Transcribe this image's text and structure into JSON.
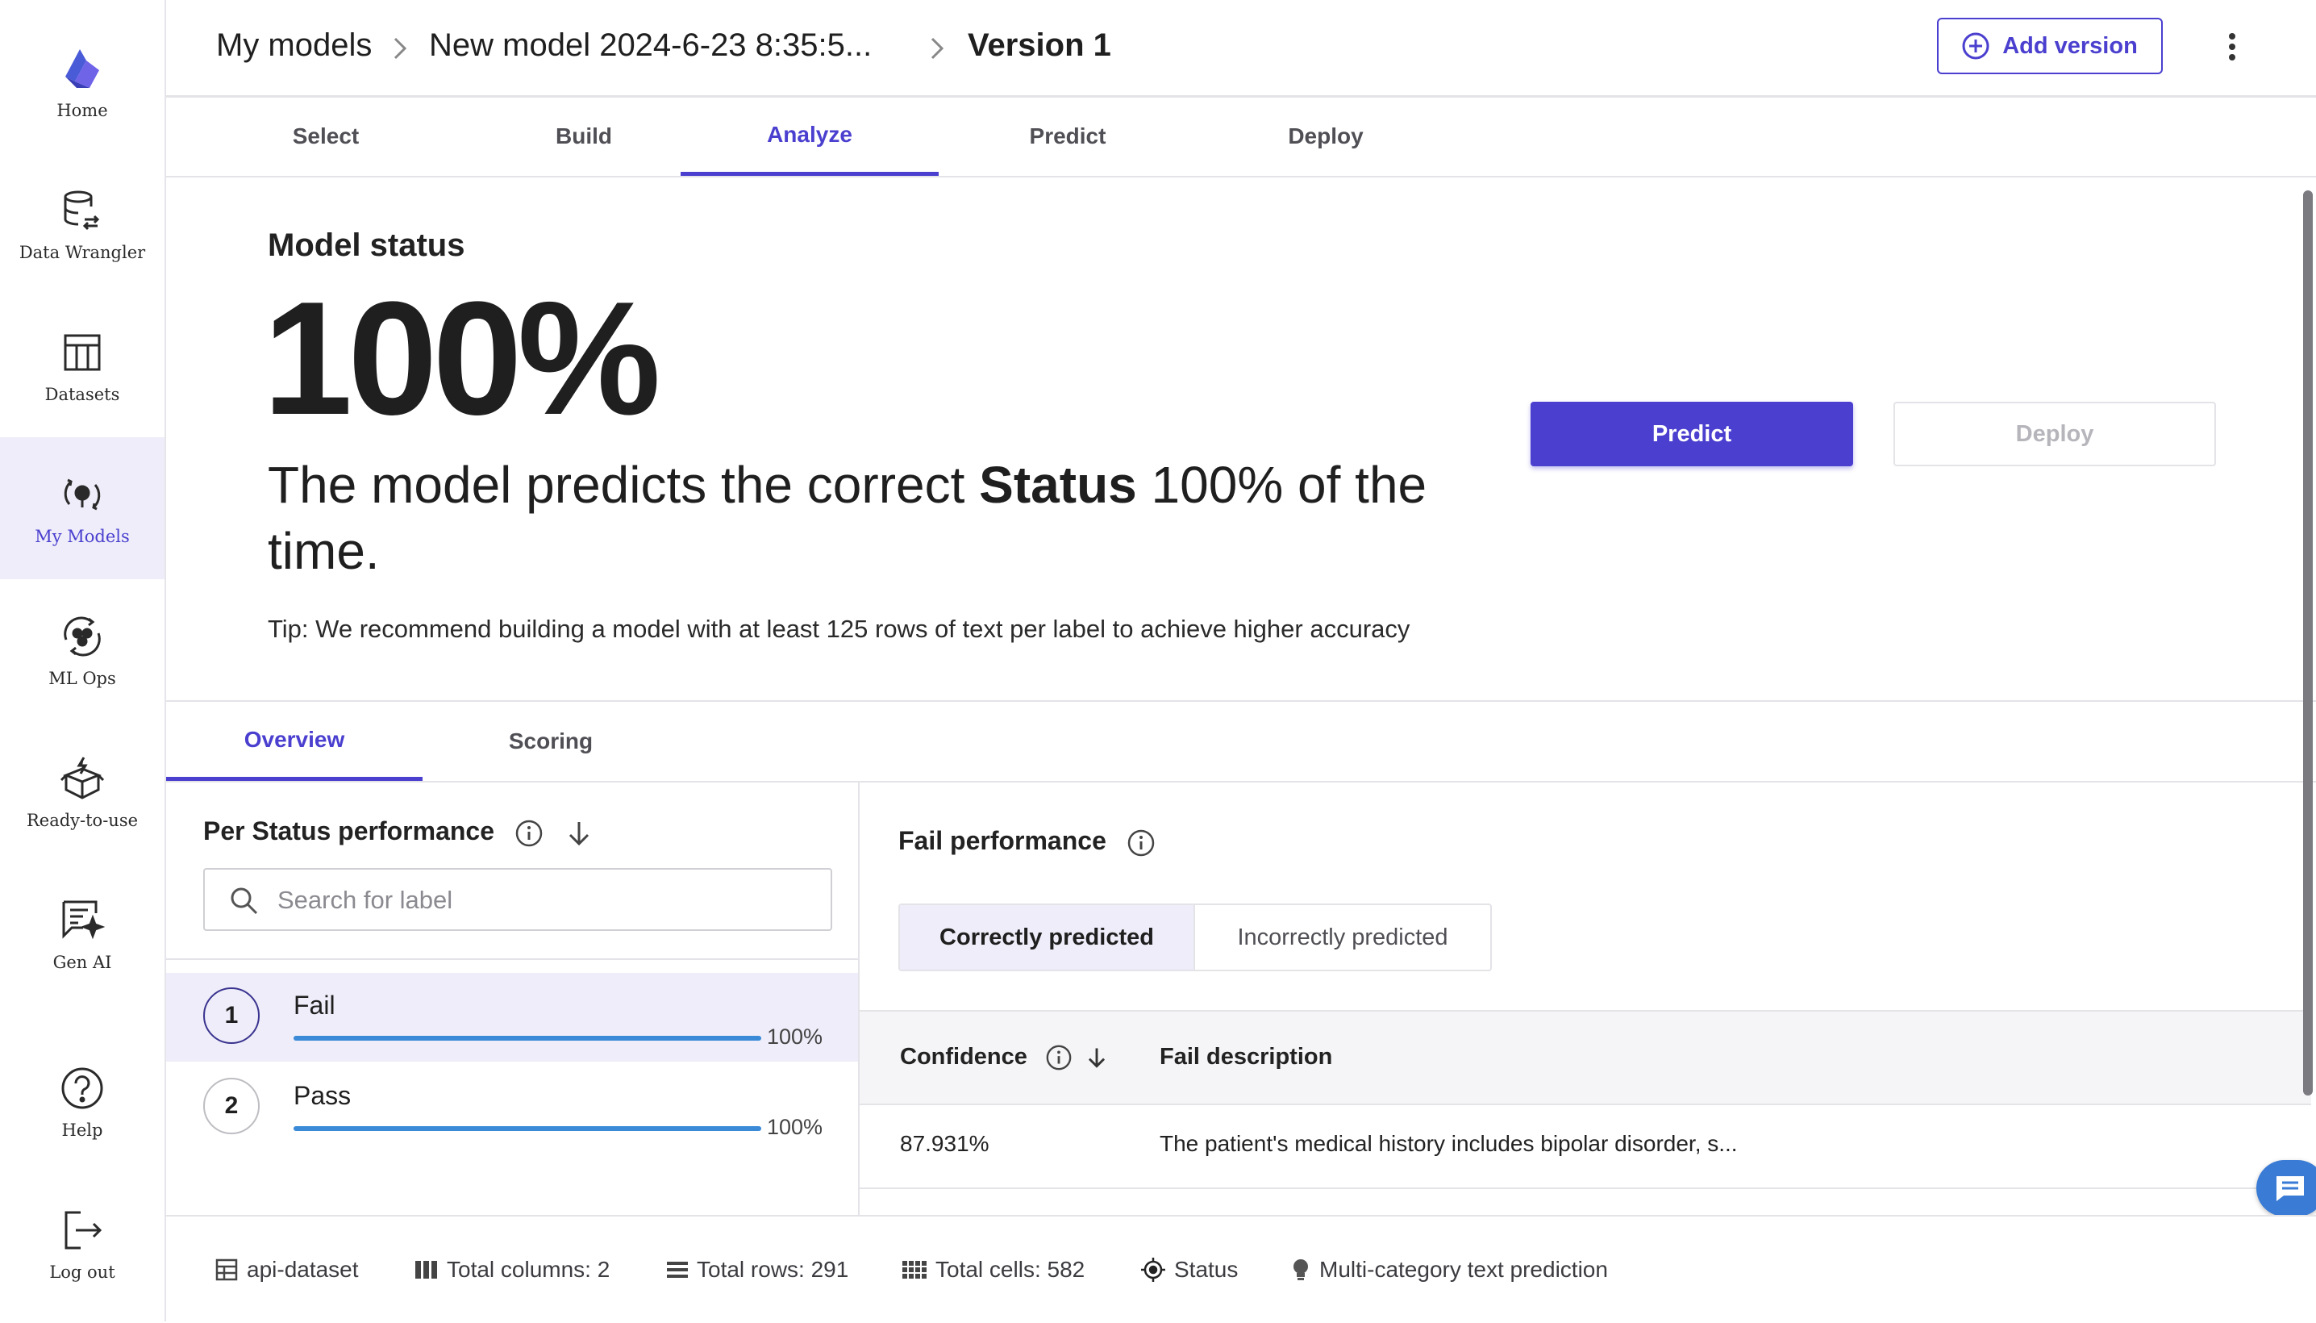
{
  "sidebar": {
    "items": [
      {
        "label": "Home",
        "icon": "canvas-logo-icon"
      },
      {
        "label": "Data Wrangler",
        "icon": "data-wrangler-icon"
      },
      {
        "label": "Datasets",
        "icon": "datasets-icon"
      },
      {
        "label": "My Models",
        "icon": "my-models-icon",
        "active": true
      },
      {
        "label": "ML Ops",
        "icon": "ml-ops-icon"
      },
      {
        "label": "Ready-to-use",
        "icon": "ready-to-use-icon"
      },
      {
        "label": "Gen AI",
        "icon": "gen-ai-icon"
      },
      {
        "label": "Help",
        "icon": "help-icon"
      },
      {
        "label": "Log out",
        "icon": "logout-icon"
      }
    ]
  },
  "header": {
    "breadcrumb": [
      "My models",
      "New model 2024-6-23 8:35:5...",
      "Version 1"
    ],
    "add_version_label": "Add version"
  },
  "main_tabs": [
    "Select",
    "Build",
    "Analyze",
    "Predict",
    "Deploy"
  ],
  "active_main_tab": "Analyze",
  "model_status": {
    "title": "Model status",
    "accuracy": "100%",
    "sentence_prefix": "The model predicts the correct ",
    "target": "Status",
    "sentence_suffix": " 100% of the time.",
    "tip": "Tip: We recommend building a model with at least 125 rows of text per label to achieve higher accuracy",
    "predict_label": "Predict",
    "deploy_label": "Deploy"
  },
  "sub_tabs": [
    "Overview",
    "Scoring"
  ],
  "active_sub_tab": "Overview",
  "per_label": {
    "title": "Per Status performance",
    "search_placeholder": "Search for label",
    "labels": [
      {
        "rank": "1",
        "name": "Fail",
        "pct_text": "100%",
        "score": 1.0,
        "selected": true
      },
      {
        "rank": "2",
        "name": "Pass",
        "pct_text": "100%",
        "score": 1.0,
        "selected": false
      }
    ]
  },
  "fail_performance": {
    "title": "Fail performance",
    "toggle": [
      "Correctly predicted",
      "Incorrectly predicted"
    ],
    "active_toggle": "Correctly predicted",
    "columns": [
      "Confidence",
      "Fail description"
    ],
    "rows": [
      {
        "confidence": "87.931%",
        "description": "The patient's medical history includes bipolar disorder, s..."
      }
    ]
  },
  "footer": {
    "dataset": "api-dataset",
    "total_columns": "Total columns: 2",
    "total_rows": "Total rows: 291",
    "total_cells": "Total cells: 582",
    "target": "Status",
    "model_type": "Multi-category text prediction"
  },
  "colors": {
    "accent": "#4a3fcf",
    "bar": "#3a8ad8",
    "selected_bg": "#eeedf9",
    "chat": "#3a7bd5"
  }
}
